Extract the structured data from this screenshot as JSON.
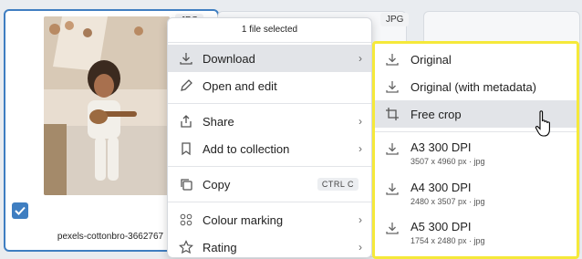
{
  "cards": {
    "card1_type": "JPG",
    "card2_type": "JPG",
    "filename": "pexels-cottonbro-3662767"
  },
  "menu": {
    "header": "1 file selected",
    "items": [
      {
        "label": "Download",
        "icon": "download-icon",
        "has_submenu": true
      },
      {
        "label": "Open and edit",
        "icon": "pencil-icon"
      },
      {
        "label": "Share",
        "icon": "share-icon",
        "has_submenu": true
      },
      {
        "label": "Add to collection",
        "icon": "bookmark-icon",
        "has_submenu": true
      },
      {
        "label": "Copy",
        "icon": "copy-icon",
        "shortcut": "CTRL C"
      },
      {
        "label": "Colour marking",
        "icon": "color-dots-icon",
        "has_submenu": true
      },
      {
        "label": "Rating",
        "icon": "star-icon",
        "has_submenu": true
      }
    ]
  },
  "submenu": {
    "items": [
      {
        "label": "Original"
      },
      {
        "label": "Original (with metadata)"
      },
      {
        "label": "Free crop"
      },
      {
        "label": "A3 300 DPI",
        "detail": "3507 x 4960 px · jpg"
      },
      {
        "label": "A4 300 DPI",
        "detail": "2480 x 3507 px · jpg"
      },
      {
        "label": "A5 300 DPI",
        "detail": "1754 x 2480 px · jpg"
      }
    ]
  },
  "colors": {
    "accent": "#3f7ec1",
    "highlight_border": "#f5e93a",
    "active_row": "#e2e4e8"
  }
}
